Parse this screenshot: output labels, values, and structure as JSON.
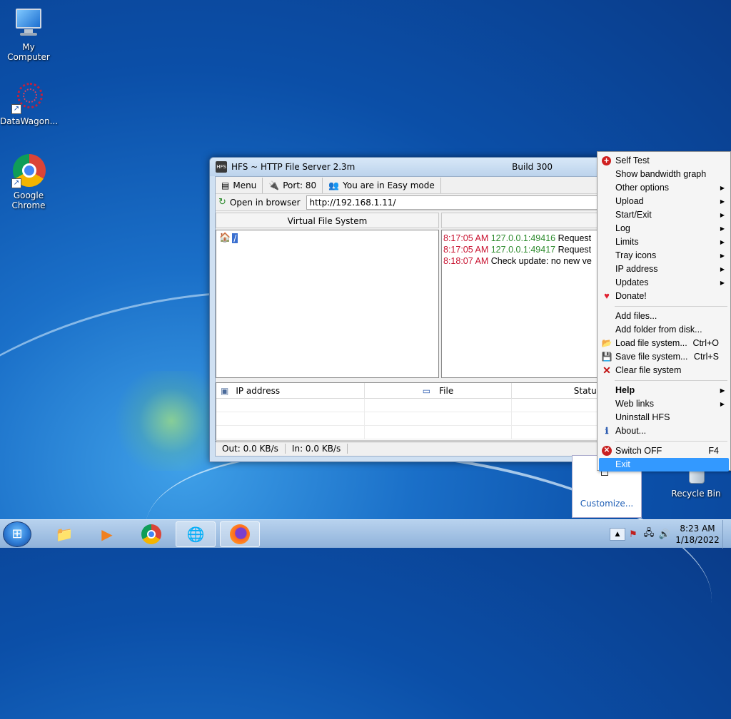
{
  "desktop": {
    "icons": [
      {
        "label": "My Computer",
        "glyph": "monitor-icon"
      },
      {
        "label": "DataWagon...",
        "glyph": "datawagon-icon"
      },
      {
        "label": "Google Chrome",
        "glyph": "chrome-icon"
      },
      {
        "label": "Recycle Bin",
        "glyph": "recycle-bin-icon"
      }
    ]
  },
  "hfs": {
    "title": "HFS ~ HTTP File Server 2.3m",
    "build": "Build 300",
    "toolbar": {
      "menu": "Menu",
      "port": "Port: 80",
      "mode": "You are in Easy mode"
    },
    "open_in_browser": "Open in browser",
    "url": "http://192.168.1.11/",
    "vfs_header": "Virtual File System",
    "vfs_root": "/",
    "log": [
      {
        "time": "8:17:05 AM",
        "ip": "127.0.0.1:49416",
        "msg": "Request"
      },
      {
        "time": "8:17:05 AM",
        "ip": "127.0.0.1:49417",
        "msg": "Request"
      },
      {
        "time": "8:18:07 AM",
        "ip": "",
        "msg": "Check update: no new ve"
      }
    ],
    "connections": {
      "ip_header": "IP address",
      "file_header": "File",
      "status_header": "Status"
    },
    "status": {
      "out": "Out: 0.0 KB/s",
      "in": "In: 0.0 KB/s"
    }
  },
  "menu": {
    "items": [
      {
        "label": "Self Test",
        "icon": "plus-circle-icon"
      },
      {
        "label": "Show bandwidth graph"
      },
      {
        "label": "Other options",
        "submenu": true
      },
      {
        "label": "Upload",
        "submenu": true
      },
      {
        "label": "Start/Exit",
        "submenu": true
      },
      {
        "label": "Log",
        "submenu": true
      },
      {
        "label": "Limits",
        "submenu": true
      },
      {
        "label": "Tray icons",
        "submenu": true
      },
      {
        "label": "IP address",
        "submenu": true
      },
      {
        "label": "Updates",
        "submenu": true
      },
      {
        "label": "Donate!",
        "icon": "heart-icon"
      },
      {
        "label": "Add files..."
      },
      {
        "label": "Add folder from disk..."
      },
      {
        "label": "Load file system...",
        "shortcut": "Ctrl+O",
        "icon": "folder-open-icon"
      },
      {
        "label": "Save file system...",
        "shortcut": "Ctrl+S",
        "icon": "floppy-icon"
      },
      {
        "label": "Clear file system",
        "icon": "x-icon"
      },
      {
        "label": "Help",
        "submenu": true
      },
      {
        "label": "Web links",
        "submenu": true
      },
      {
        "label": "Uninstall HFS"
      },
      {
        "label": "About...",
        "icon": "info-icon"
      },
      {
        "label": "Switch OFF",
        "shortcut": "F4",
        "icon": "power-off-icon"
      },
      {
        "label": "Exit"
      }
    ]
  },
  "tray_popup": {
    "customize": "Customize..."
  },
  "taskbar": {
    "clock_time": "8:23 AM",
    "clock_date": "1/18/2022"
  }
}
